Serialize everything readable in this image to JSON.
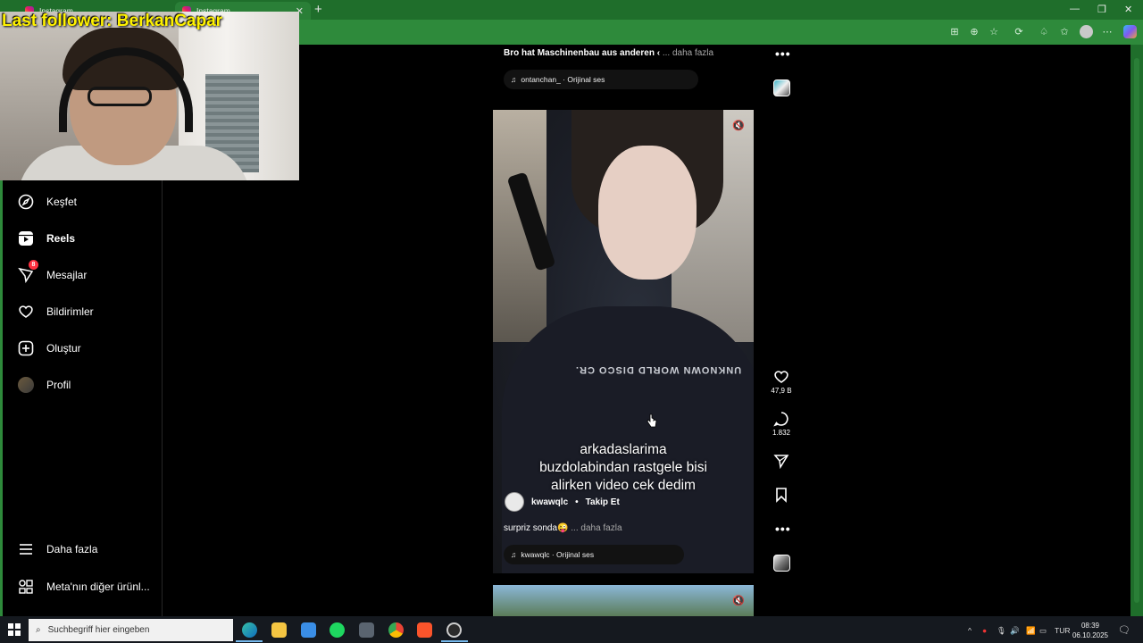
{
  "browser": {
    "tabs": [
      {
        "label": "Instagram"
      },
      {
        "label": "Instagram"
      }
    ],
    "new_tab": "+",
    "window_controls": {
      "minimize": "—",
      "maximize": "❐",
      "close": "✕"
    }
  },
  "stream": {
    "overlay_label": "Last follower: BerkanCapar"
  },
  "sidebar": {
    "items": [
      {
        "label": "Keşfet"
      },
      {
        "label": "Reels"
      },
      {
        "label": "Mesajlar",
        "badge": "8"
      },
      {
        "label": "Bildirimler"
      },
      {
        "label": "Oluştur"
      },
      {
        "label": "Profil"
      },
      {
        "label": "Daha fazla"
      },
      {
        "label": "Meta'nın diğer ürünl..."
      }
    ]
  },
  "feed": {
    "prev_post": {
      "caption": "Bro hat Maschinenbau aus anderen ‹",
      "more": "... daha fazla",
      "audio": "ontanchan_ · Orijinal ses"
    },
    "current_post": {
      "overlay_lines": [
        "arkadaslarima",
        "buzdolabindan rastgele bisi",
        "alirken video cek dedim"
      ],
      "author": "kwawqlc",
      "separator": "•",
      "follow": "Takip Et",
      "caption": "surpriz sonda😜",
      "more": "... daha fazla",
      "audio": "kwawqlc · Orijinal ses",
      "likes": "47,9 B",
      "comments": "1.832",
      "hoodie_print": "UNKNOWN WORLD DISCO CR."
    },
    "more_icon": "•••",
    "mute_icon": "🔇"
  },
  "taskbar": {
    "search_placeholder": "Suchbegriff hier eingeben",
    "language": "TUR",
    "time": "08:39",
    "date": "06.10.2025"
  },
  "colors": {
    "browser_green": "#2e8a3b",
    "tab_green": "#1f6e2b",
    "badge_red": "#ff3040",
    "overlay_yellow": "#fff200"
  }
}
